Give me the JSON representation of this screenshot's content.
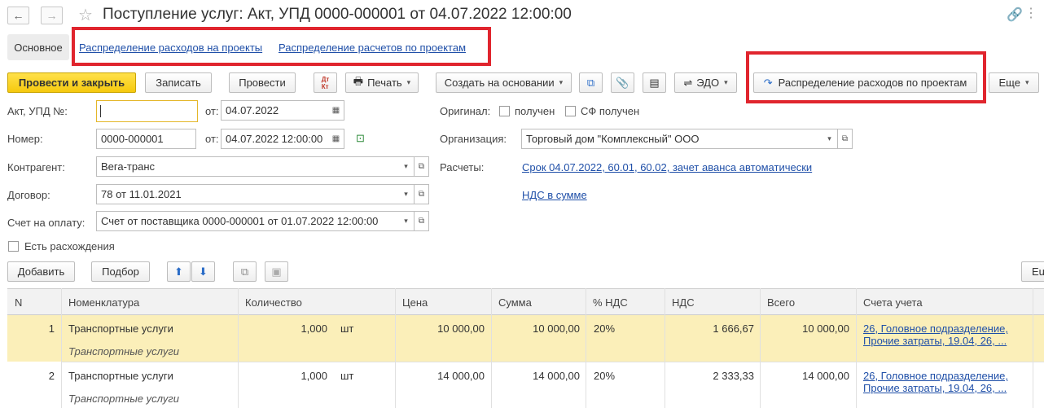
{
  "window": {
    "title": "Поступление услуг: Акт, УПД 0000-000001 от 04.07.2022 12:00:00",
    "back_icon": "arrow-left-icon",
    "forward_icon": "arrow-right-icon",
    "favorite_icon": "star-icon"
  },
  "nav": {
    "main_tab": "Основное",
    "link1": "Распределение расходов на проекты",
    "link2": "Распределение расчетов по проектам"
  },
  "toolbar": {
    "post_close": "Провести и закрыть",
    "save": "Записать",
    "post": "Провести",
    "print": "Печать",
    "create_based": "Создать на основании",
    "edo": "ЭДО",
    "distribute": "Распределение расходов по проектам",
    "more": "Еще"
  },
  "form": {
    "act_label": "Акт, УПД №:",
    "act_value": "",
    "from_label": "от:",
    "act_date": "04.07.2022",
    "number_label": "Номер:",
    "number_value": "0000-000001",
    "number_date": "04.07.2022 12:00:00",
    "counterparty_label": "Контрагент:",
    "counterparty_value": "Вега-транс",
    "contract_label": "Договор:",
    "contract_value": "78 от 11.01.2021",
    "invoice_label": "Счет на оплату:",
    "invoice_value": "Счет от поставщика 0000-000001 от 01.07.2022 12:00:00",
    "discrepancy_label": "Есть расхождения",
    "original_label": "Оригинал:",
    "received_label": "получен",
    "sf_received_label": "СФ получен",
    "org_label": "Организация:",
    "org_value": "Торговый дом \"Комплексный\" ООО",
    "settlements_label": "Расчеты:",
    "settlements_link": "Срок 04.07.2022, 60.01, 60.02, зачет аванса автоматически",
    "vat_link": "НДС в сумме"
  },
  "table_toolbar": {
    "add": "Добавить",
    "select": "Подбор",
    "right_btn": "Eu"
  },
  "table": {
    "headers": [
      "N",
      "Номенклатура",
      "Количество",
      "Цена",
      "Сумма",
      "% НДС",
      "НДС",
      "Всего",
      "Счета учета"
    ],
    "rows": [
      {
        "n": "1",
        "item": "Транспортные услуги",
        "item_sub": "Транспортные услуги",
        "qty": "1,000",
        "unit": "шт",
        "price": "10 000,00",
        "sum": "10 000,00",
        "vat_rate": "20%",
        "vat": "1 666,67",
        "total": "10 000,00",
        "acc1": "26, Головное подразделение,",
        "acc2": "Прочие затраты, 19.04, 26, ..."
      },
      {
        "n": "2",
        "item": "Транспортные услуги",
        "item_sub": "Транспортные услуги",
        "qty": "1,000",
        "unit": "шт",
        "price": "14 000,00",
        "sum": "14 000,00",
        "vat_rate": "20%",
        "vat": "2 333,33",
        "total": "14 000,00",
        "acc1": "26, Головное подразделение,",
        "acc2": "Прочие затраты, 19.04, 26, ..."
      }
    ]
  },
  "highlight_color": "#e0252e",
  "selected_row_color": "#fbefb9",
  "primary_button_color": "#f6c90e"
}
